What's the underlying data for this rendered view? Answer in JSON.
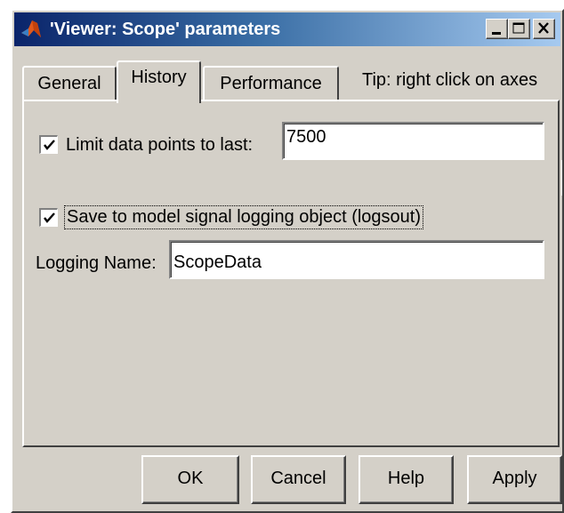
{
  "window": {
    "title": "'Viewer: Scope' parameters"
  },
  "titlebar_buttons": {
    "minimize_icon": "minimize-icon",
    "maximize_icon": "maximize-icon",
    "close_icon": "close-icon"
  },
  "tabs": [
    {
      "label": "General",
      "selected": false
    },
    {
      "label": "History",
      "selected": true
    },
    {
      "label": "Performance",
      "selected": false
    }
  ],
  "tip": "Tip: right click on axes",
  "history": {
    "limit_checkbox": {
      "label": "Limit data points to last:",
      "checked": true
    },
    "limit_value": "7500",
    "save_checkbox": {
      "label": "Save to model signal logging object (logsout)",
      "checked": true
    },
    "logging_name_label": "Logging Name:",
    "logging_name_value": "ScopeData"
  },
  "buttons": {
    "ok": "OK",
    "cancel": "Cancel",
    "help": "Help",
    "apply": "Apply"
  },
  "colors": {
    "titlebar_start": "#0a246a",
    "titlebar_end": "#a6caf0",
    "face": "#d4d0c8"
  }
}
